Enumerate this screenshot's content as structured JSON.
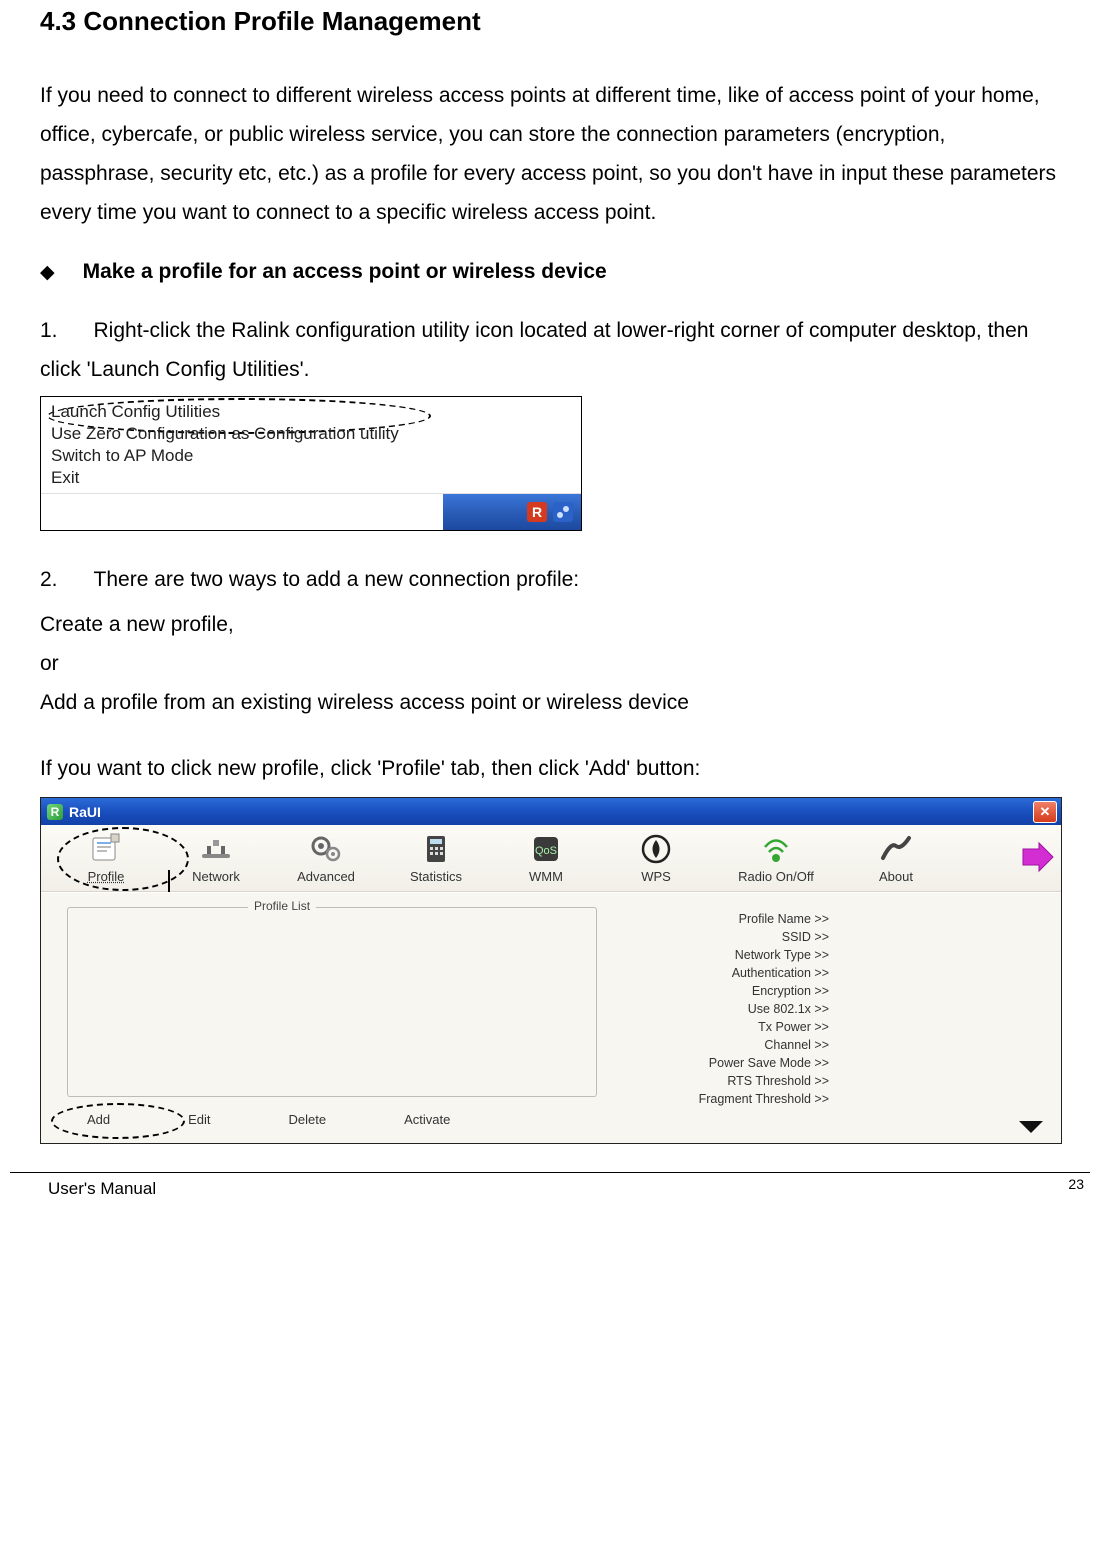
{
  "heading": "4.3 Connection Profile Management",
  "intro": "If you need to connect to different wireless access points at different time, like of access point of your home, office, cybercafe, or public wireless service, you can store the connection parameters (encryption, passphrase, security etc, etc.) as a profile for every access point, so you don't have in input these parameters every time you want to connect to a specific wireless access point.",
  "bullet": "Make a profile for an access point or wireless device",
  "step1_num": "1.",
  "step1": "Right-click the Ralink configuration utility icon located at lower-right corner of computer desktop, then click 'Launch Config Utilities'.",
  "context_menu": {
    "items": [
      "Launch Config Utilities",
      "Use Zero Configuration as Configuration utility",
      "Switch to AP Mode",
      "Exit"
    ]
  },
  "step2_num": "2.",
  "step2": "There are two ways to add a new connection profile:",
  "line_a": "Create a new profile,",
  "line_b": "or",
  "line_c": "Add a profile from an existing wireless access point or wireless device",
  "line_d": "If you want to click new profile, click 'Profile' tab, then click 'Add' button:",
  "raui": {
    "title": "RaUI",
    "r_glyph": "R",
    "close_glyph": "✕",
    "tabs": [
      "Profile",
      "Network",
      "Advanced",
      "Statistics",
      "WMM",
      "WPS",
      "Radio On/Off",
      "About"
    ],
    "profile_list_label": "Profile List",
    "details": [
      "Profile Name >>",
      "SSID >>",
      "Network Type >>",
      "Authentication >>",
      "Encryption >>",
      "Use 802.1x >>",
      "Tx Power >>",
      "Channel >>",
      "Power Save Mode >>",
      "RTS Threshold >>",
      "Fragment Threshold >>"
    ],
    "buttons": [
      "Add",
      "Edit",
      "Delete",
      "Activate"
    ]
  },
  "footer_left": "User's Manual",
  "footer_right": "23"
}
